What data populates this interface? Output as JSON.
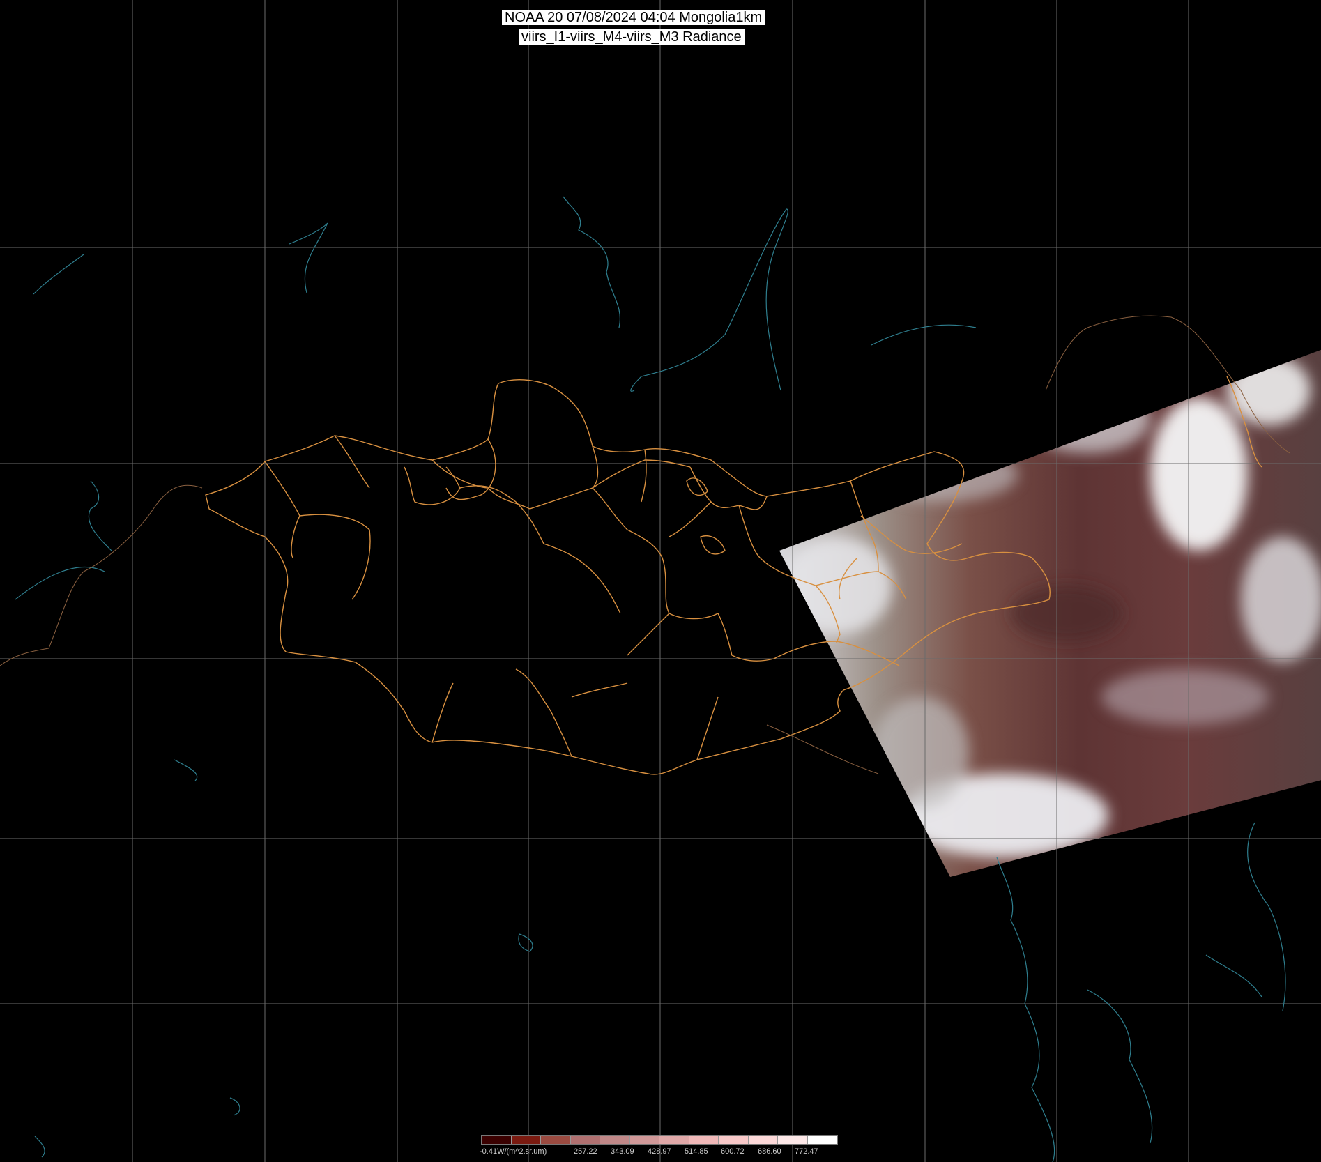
{
  "title": {
    "line1": "NOAA 20 07/08/2024 04:04 Mongolia1km",
    "line2": "viirs_I1-viirs_M4-viirs_M3 Radiance"
  },
  "legend": {
    "labels": [
      "-0.41W/(m^2.sr.um)",
      "257.22",
      "343.09",
      "428.97",
      "514.85",
      "600.72",
      "686.60",
      "772.47"
    ],
    "colors": [
      "#3a0000",
      "#7a1a10",
      "#9a4a40",
      "#b07070",
      "#c08888",
      "#d09898",
      "#e0a8a8",
      "#f0b8b8",
      "#f8c8c8",
      "#fcd8d8",
      "#fde8e8",
      "#ffffff"
    ]
  },
  "colors": {
    "background": "#000000",
    "grid": "#6b6b6b",
    "borders": "#d89040",
    "coast": "#2f7f8f",
    "country_border": "#8a6040"
  }
}
